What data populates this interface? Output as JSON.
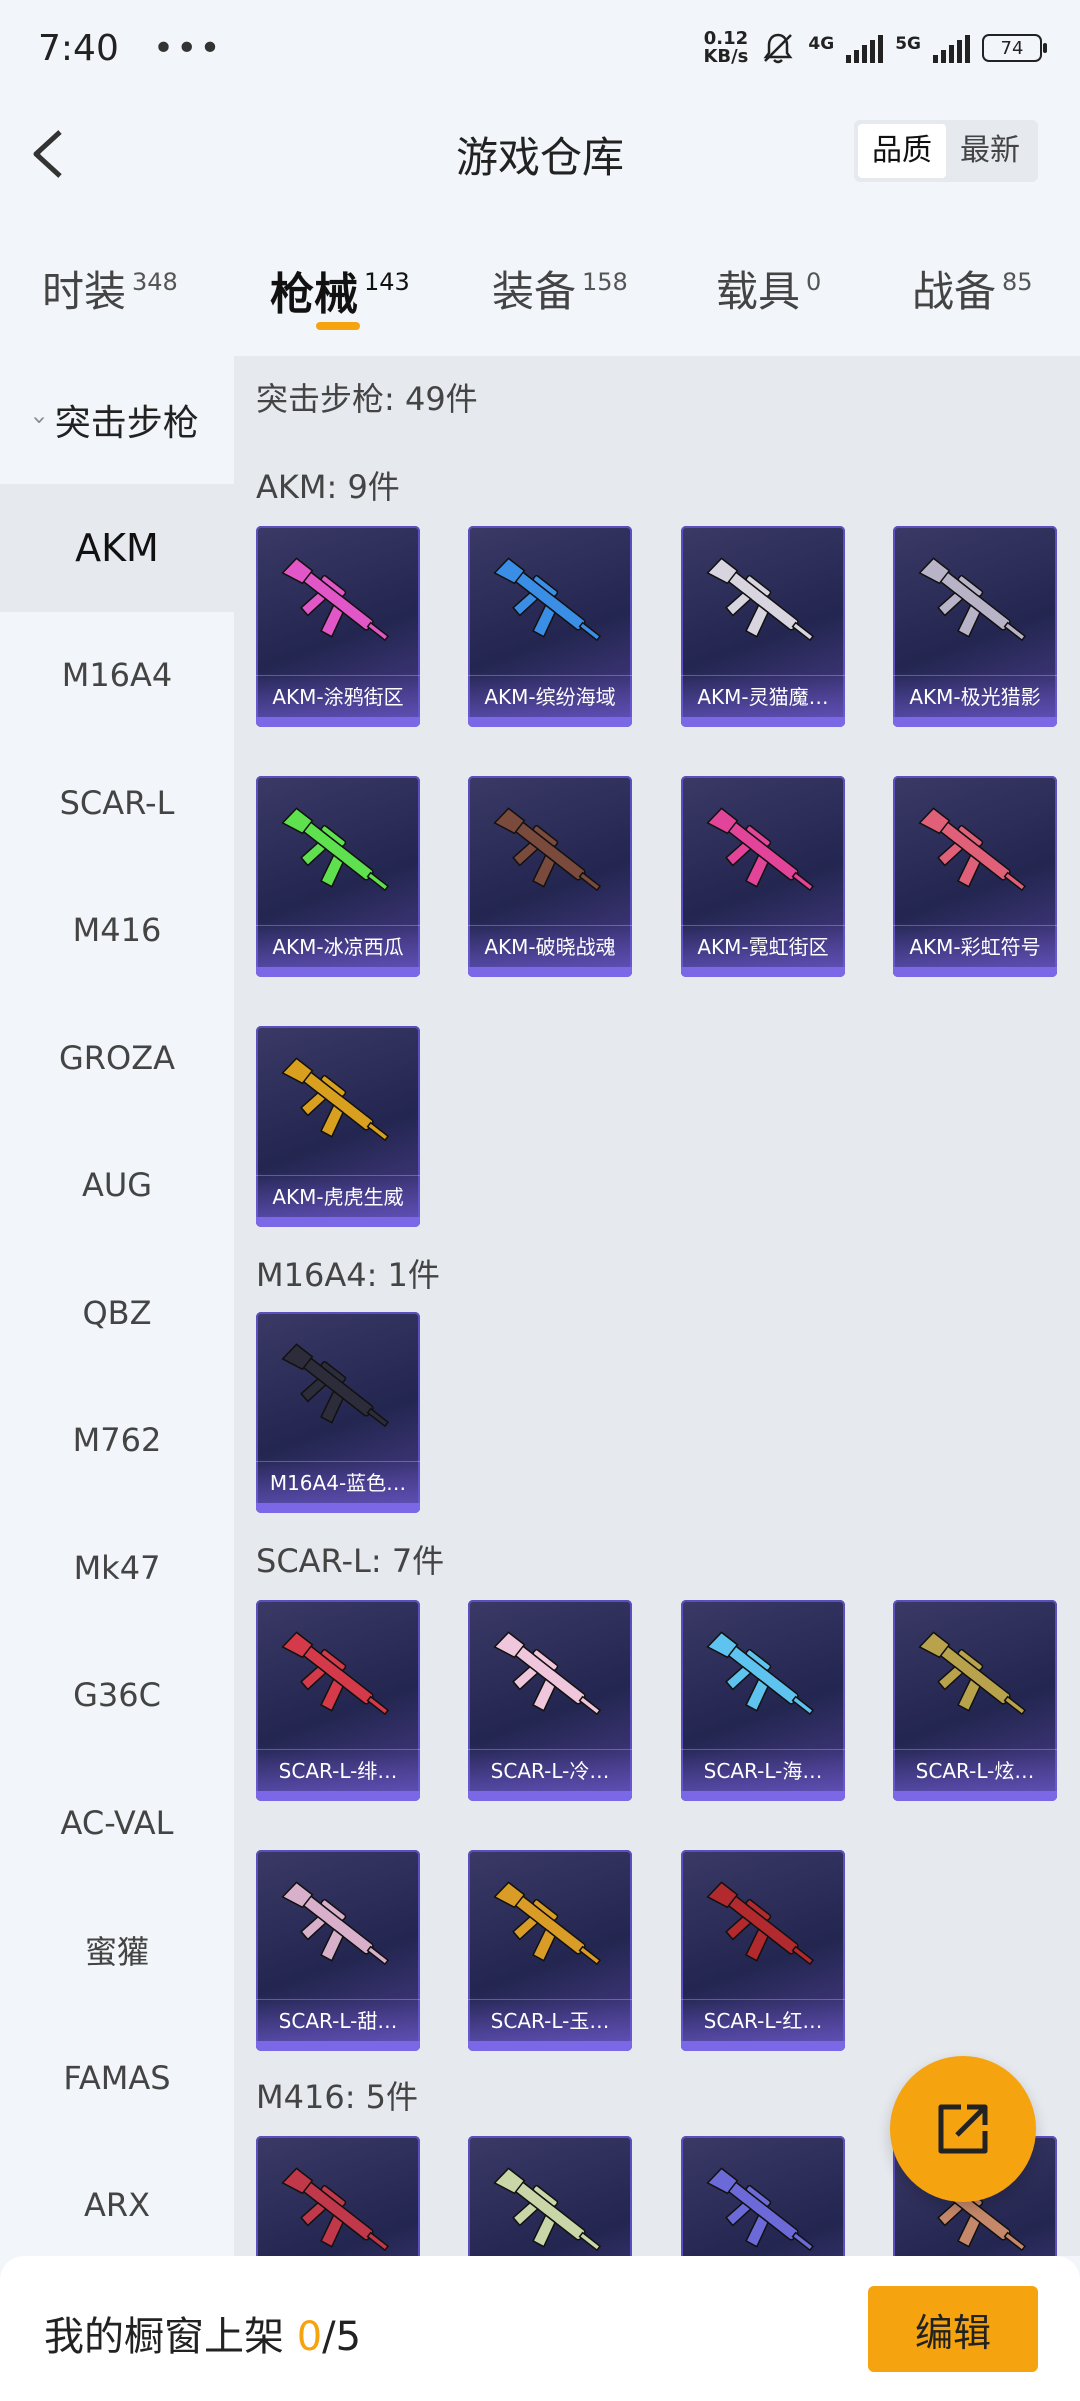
{
  "status_bar": {
    "time": "7:40",
    "more": "•••",
    "net_speed_value": "0.12",
    "net_speed_unit": "KB/s",
    "net_gen_1": "4G",
    "net_gen_2": "5G",
    "battery": "74",
    "icons": [
      "bell-muted-icon",
      "signal-icon",
      "battery-icon"
    ]
  },
  "header": {
    "title": "游戏仓库",
    "sort_options": [
      "品质",
      "最新"
    ],
    "selected_sort": "品质"
  },
  "tabs": [
    {
      "label": "时装",
      "count": "348"
    },
    {
      "label": "枪械",
      "count": "143"
    },
    {
      "label": "装备",
      "count": "158"
    },
    {
      "label": "载具",
      "count": "0"
    },
    {
      "label": "战备",
      "count": "85"
    }
  ],
  "active_tab": "枪械",
  "sidebar": {
    "category": "突击步枪",
    "items": [
      "AKM",
      "M16A4",
      "SCAR-L",
      "M416",
      "GROZA",
      "AUG",
      "QBZ",
      "M762",
      "Mk47",
      "G36C",
      "AC-VAL",
      "蜜獾",
      "FAMAS",
      "ARX"
    ],
    "active": "AKM"
  },
  "content": {
    "summary": "突击步枪: 49件",
    "groups": [
      {
        "title": "AKM: 9件",
        "items": [
          "AKM-涂鸦街区",
          "AKM-缤纷海域",
          "AKM-灵猫魔…",
          "AKM-极光猎影",
          "AKM-冰凉西瓜",
          "AKM-破晓战魂",
          "AKM-霓虹街区",
          "AKM-彩虹符号",
          "AKM-虎虎生威"
        ]
      },
      {
        "title": "M16A4: 1件",
        "items": [
          "M16A4-蓝色…"
        ]
      },
      {
        "title": "SCAR-L: 7件",
        "items": [
          "SCAR-L-绯…",
          "SCAR-L-冷…",
          "SCAR-L-海…",
          "SCAR-L-炫…",
          "SCAR-L-甜…",
          "SCAR-L-玉…",
          "SCAR-L-红…"
        ]
      },
      {
        "title": "M416: 5件",
        "items": []
      }
    ]
  },
  "bottom": {
    "label": "我的橱窗上架",
    "current": "0",
    "total": "/5",
    "edit_label": "编辑"
  },
  "colors": {
    "accent": "#f5a30f",
    "card_bg": "#2a2b5a",
    "card_border": "#5b4fc0"
  }
}
